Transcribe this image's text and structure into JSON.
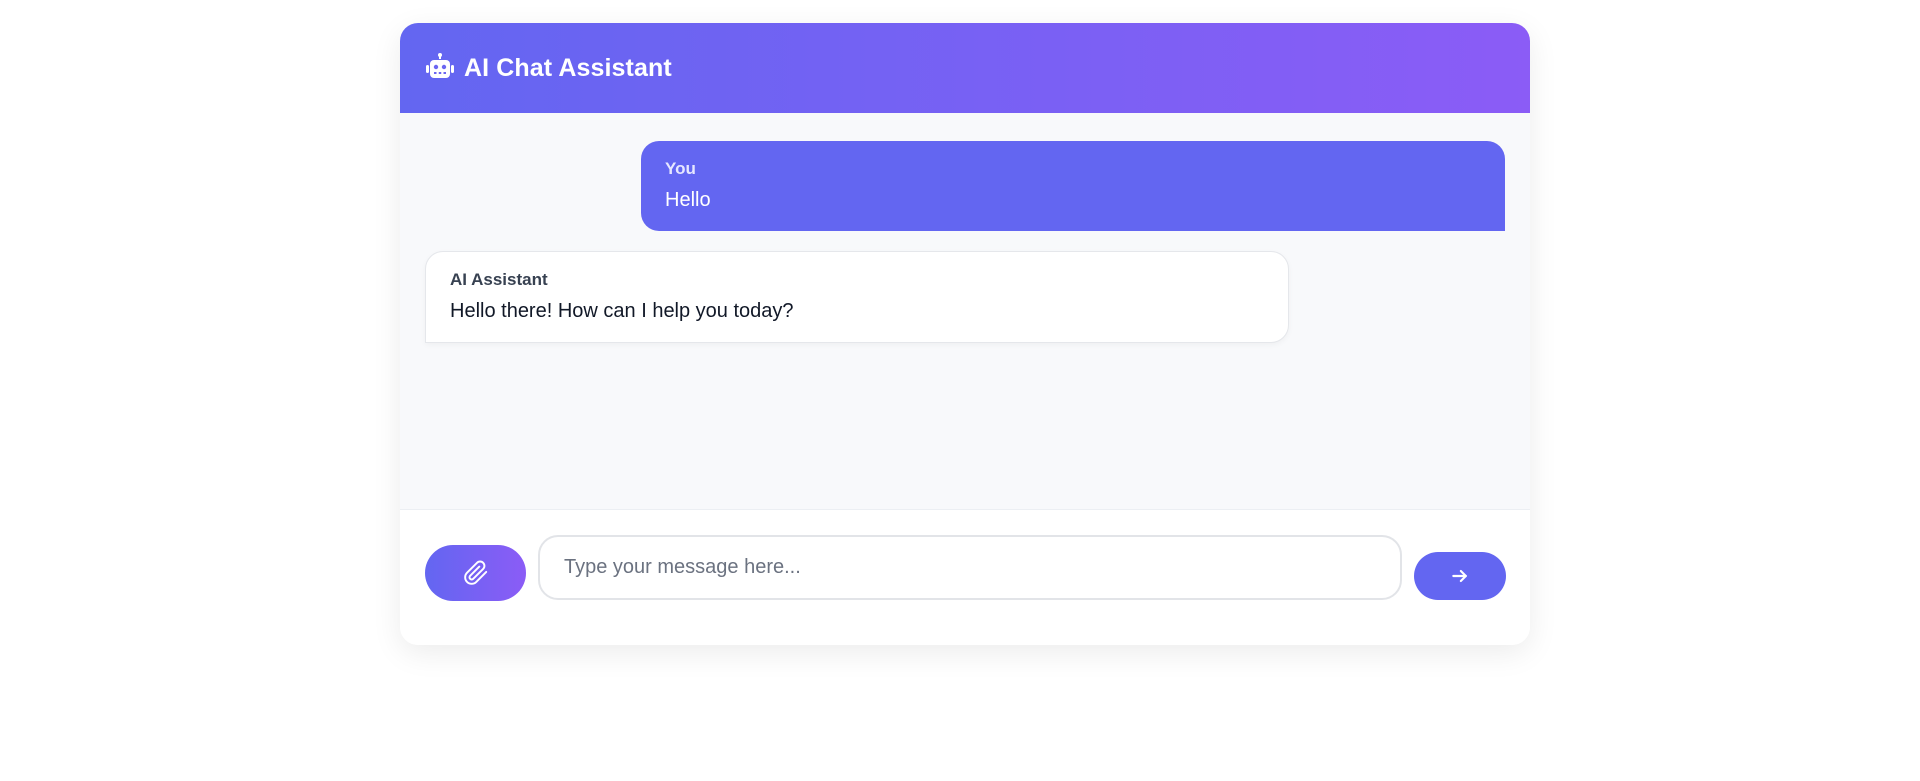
{
  "header": {
    "icon": "robot-icon",
    "title": "AI Chat Assistant"
  },
  "messages": [
    {
      "role": "user",
      "sender": "You",
      "text": "Hello"
    },
    {
      "role": "assistant",
      "sender": "AI Assistant",
      "text": "Hello there! How can I help you today?"
    }
  ],
  "composer": {
    "attach_icon": "paperclip-icon",
    "placeholder": "Type your message here...",
    "value": "",
    "send_icon": "arrow-right-icon"
  },
  "colors": {
    "accent": "#6366f1",
    "accent_gradient_end": "#8b5cf6",
    "messages_bg": "#f8f9fb"
  }
}
